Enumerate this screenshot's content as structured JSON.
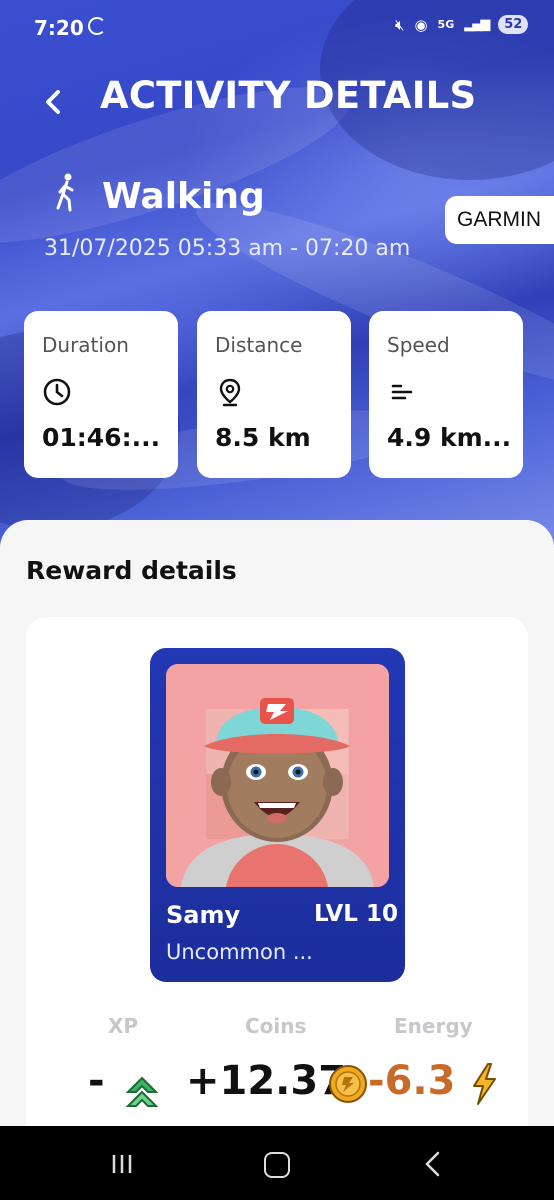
{
  "status_bar": {
    "time": "7:20",
    "network": "5G",
    "battery": "52"
  },
  "header": {
    "title": "ACTIVITY DETAILS"
  },
  "activity": {
    "name": "Walking",
    "time_range": "31/07/2025 05:33 am - 07:20 am",
    "source": "GARMIN"
  },
  "stats": [
    {
      "label": "Duration",
      "value": "01:46:...",
      "icon": "clock-icon"
    },
    {
      "label": "Distance",
      "value": "8.5 km",
      "icon": "location-pin-icon"
    },
    {
      "label": "Speed",
      "value": "4.9 km...",
      "icon": "speed-lines-icon"
    }
  ],
  "rewards": {
    "title": "Reward details",
    "nft": {
      "name": "Samy",
      "level": "LVL 10",
      "rarity": "Uncommon ..."
    },
    "xp": {
      "label": "XP",
      "value": "-"
    },
    "coins": {
      "label": "Coins",
      "value": "+12.37"
    },
    "energy": {
      "label": "Energy",
      "value": "-6.3"
    }
  },
  "colors": {
    "card_blue": "#2238b4",
    "energy_orange": "#c96b28",
    "coin_gold": "#f0a820",
    "xp_green": "#39b05a"
  }
}
